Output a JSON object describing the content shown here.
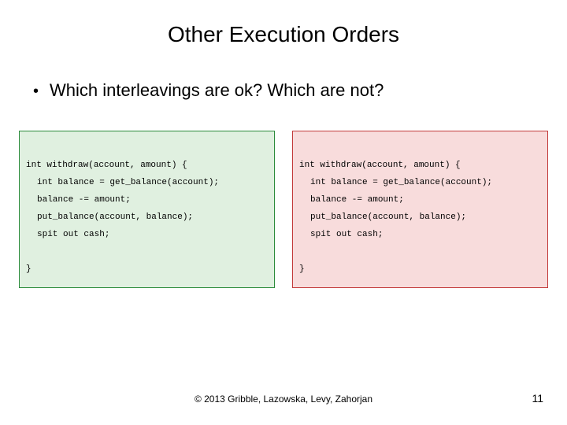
{
  "title": "Other Execution Orders",
  "bullet": "Which interleavings are ok?  Which are not?",
  "code": {
    "sig": "int withdraw(account, amount) {",
    "l1": "int balance = get_balance(account);",
    "l2": "balance -= amount;",
    "l3": "put_balance(account, balance);",
    "l4": "spit out cash;",
    "close": "}"
  },
  "footer": "© 2013 Gribble, Lazowska, Levy, Zahorjan",
  "page": "11"
}
